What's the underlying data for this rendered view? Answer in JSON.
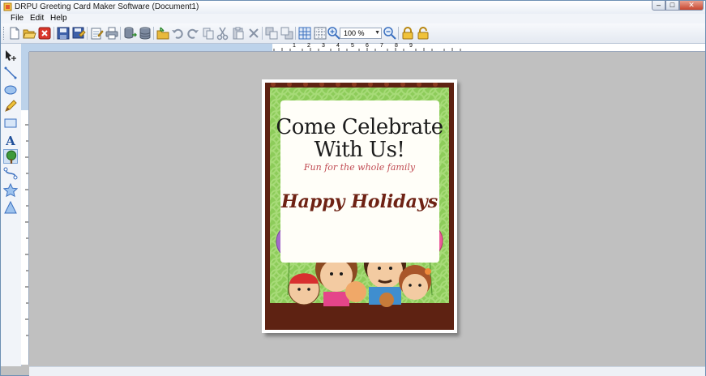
{
  "window": {
    "title": "DRPU Greeting Card Maker Software  (Document1)"
  },
  "menu": [
    {
      "label": "File"
    },
    {
      "label": "Edit"
    },
    {
      "label": "Help"
    }
  ],
  "toolbar": {
    "zoom_value": "100 %"
  },
  "ruler": {
    "marks": [
      "1",
      "2",
      "3",
      "4",
      "5",
      "6",
      "7",
      "8",
      "9"
    ]
  },
  "card": {
    "title_line1": "Come Celebrate",
    "title_line2": "With Us!",
    "subtitle": "Fun for the whole family",
    "greeting": "Happy Holidays"
  },
  "colors": {
    "card_border": "#5e2212",
    "card_green": "#8dcc5a",
    "greeting_text": "#6e2214",
    "subtitle_text": "#c04a52"
  }
}
